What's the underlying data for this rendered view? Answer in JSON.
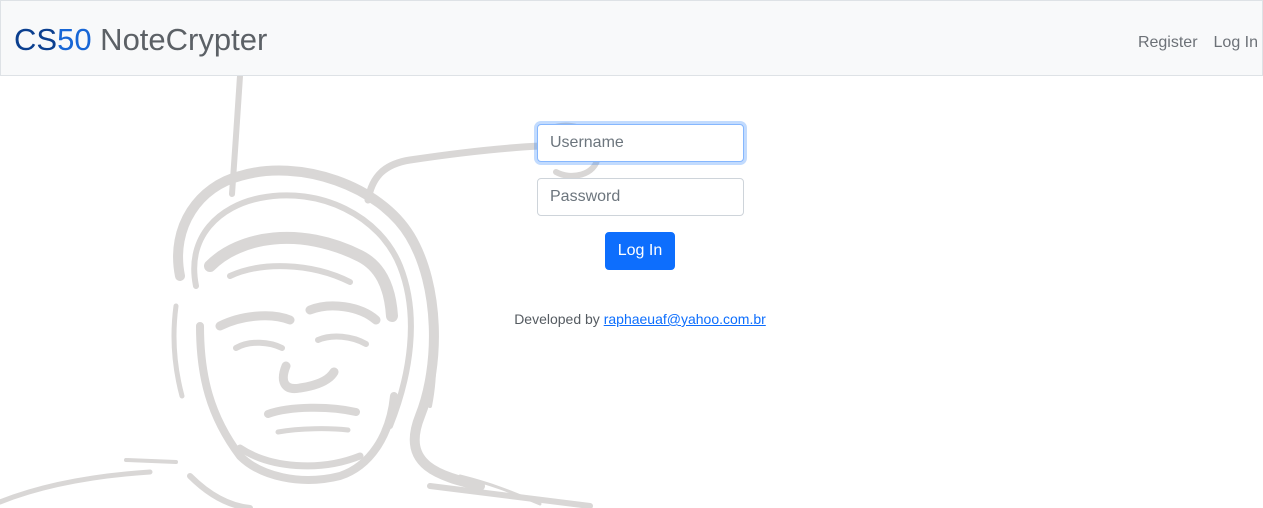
{
  "navbar": {
    "brand_part1": "CS",
    "brand_part2": "50",
    "brand_part3": " NoteCrypter",
    "links": [
      {
        "label": "Register"
      },
      {
        "label": "Log In"
      }
    ]
  },
  "login_form": {
    "username_placeholder": "Username",
    "password_placeholder": "Password",
    "submit_label": "Log In"
  },
  "footer": {
    "prefix": "Developed by ",
    "email": "raphaeuaf@yahoo.com.br"
  },
  "colors": {
    "accent": "#0d6efd",
    "brand_dark": "#0b3f8f",
    "brand_light": "#1766d6",
    "navbar_bg": "#f8f9fa",
    "sketch_gray": "#d9d7d6"
  }
}
